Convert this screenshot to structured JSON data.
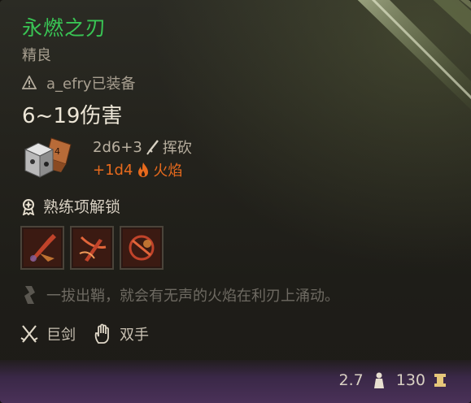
{
  "item": {
    "name": "永燃之刃",
    "rarity": "精良",
    "equipped_by": "a_efry已装备",
    "damage": "6~19伤害",
    "dice_base": "2d6+3",
    "damage_type": "挥砍",
    "bonus_damage": "+1d4",
    "bonus_type": "火焰",
    "proficiency_label": "熟练项解锁",
    "skills": [
      "skill-1",
      "skill-2",
      "skill-3"
    ],
    "description": "一拔出鞘，就会有无声的火焰在利刃上涌动。",
    "weapon_type": "巨剑",
    "handedness": "双手",
    "weight": "2.7",
    "value": "130"
  },
  "colors": {
    "name": "#39c454",
    "fire": "#e76a1d",
    "footer": "#4a3158"
  }
}
